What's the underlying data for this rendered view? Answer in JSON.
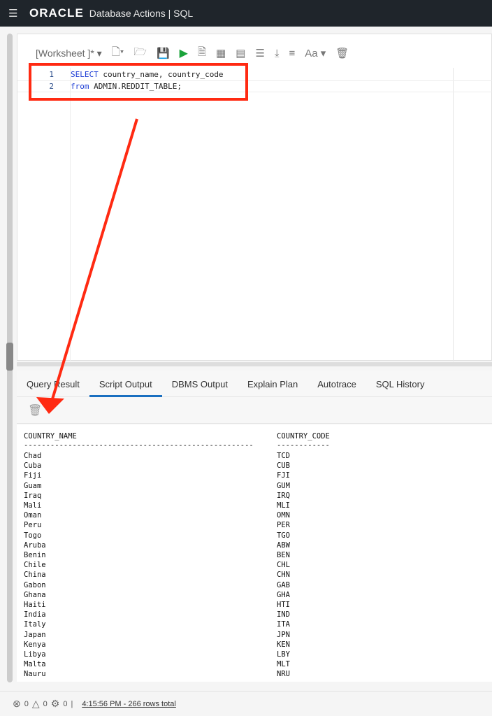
{
  "header": {
    "logo": "ORACLE",
    "app_title": "Database Actions | SQL",
    "menu_icon": "hamburger-icon"
  },
  "toolbar": {
    "worksheet_label": "[Worksheet ]*",
    "icons": [
      "new-file-icon",
      "open-folder-icon",
      "save-icon",
      "run-statement-icon",
      "run-script-icon",
      "autotrace-icon",
      "explain-plan-icon",
      "sql-tuning-icon",
      "download-icon",
      "format-icon",
      "font-size-icon",
      "trash-icon"
    ],
    "font_label": "Aa",
    "run_color": "#1aa33b"
  },
  "editor": {
    "lines": [
      {
        "num": "1",
        "kw": "SELECT",
        "rest": " country_name, country_code"
      },
      {
        "num": "2",
        "kw": "from",
        "rest": " ADMIN.REDDIT_TABLE;"
      }
    ]
  },
  "tabs": [
    {
      "label": "Query Result"
    },
    {
      "label": "Script Output",
      "active": true
    },
    {
      "label": "DBMS Output"
    },
    {
      "label": "Explain Plan"
    },
    {
      "label": "Autotrace"
    },
    {
      "label": "SQL History"
    }
  ],
  "output": {
    "headers": [
      "COUNTRY_NAME",
      "COUNTRY_CODE"
    ],
    "sep1": "----------------------------------------------------",
    "sep2": "------------",
    "rows": [
      [
        "Chad",
        "TCD"
      ],
      [
        "Cuba",
        "CUB"
      ],
      [
        "Fiji",
        "FJI"
      ],
      [
        "Guam",
        "GUM"
      ],
      [
        "Iraq",
        "IRQ"
      ],
      [
        "Mali",
        "MLI"
      ],
      [
        "Oman",
        "OMN"
      ],
      [
        "Peru",
        "PER"
      ],
      [
        "Togo",
        "TGO"
      ],
      [
        "Aruba",
        "ABW"
      ],
      [
        "Benin",
        "BEN"
      ],
      [
        "Chile",
        "CHL"
      ],
      [
        "China",
        "CHN"
      ],
      [
        "Gabon",
        "GAB"
      ],
      [
        "Ghana",
        "GHA"
      ],
      [
        "Haiti",
        "HTI"
      ],
      [
        "India",
        "IND"
      ],
      [
        "Italy",
        "ITA"
      ],
      [
        "Japan",
        "JPN"
      ],
      [
        "Kenya",
        "KEN"
      ],
      [
        "Libya",
        "LBY"
      ],
      [
        "Malta",
        "MLT"
      ],
      [
        "Nauru",
        "NRU"
      ]
    ]
  },
  "status": {
    "errors": "0",
    "warnings": "0",
    "tasks": "0",
    "message": "4:15:56 PM - 266 rows total"
  },
  "annotation_color": "#ff2a12"
}
